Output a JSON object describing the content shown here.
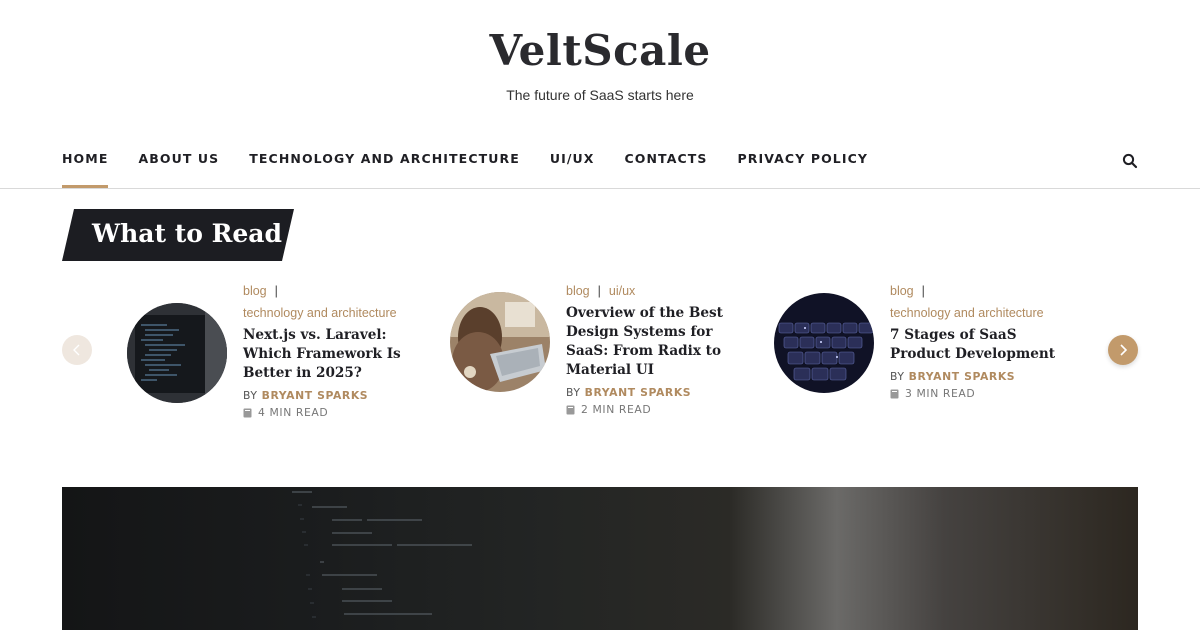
{
  "site": {
    "title": "VeltScale",
    "tagline": "The future of SaaS starts here"
  },
  "nav": {
    "items": [
      {
        "label": "HOME",
        "active": true
      },
      {
        "label": "ABOUT US"
      },
      {
        "label": "TECHNOLOGY AND ARCHITECTURE"
      },
      {
        "label": "UI/UX"
      },
      {
        "label": "CONTACTS"
      },
      {
        "label": "PRIVACY POLICY"
      }
    ],
    "search_icon": "search-icon"
  },
  "section": {
    "title": "What to Read"
  },
  "carousel": {
    "prev_icon": "chevron-left-icon",
    "next_icon": "chevron-right-icon",
    "cards": [
      {
        "categories": [
          "blog",
          "technology and architecture"
        ],
        "title": "Next.js vs. Laravel: Which Framework Is Better in 2025?",
        "by": "BY",
        "author": "BRYANT SPARKS",
        "read_time": "4 MIN READ"
      },
      {
        "categories": [
          "blog",
          "ui/ux"
        ],
        "title": "Overview of the Best Design Systems for SaaS: From Radix to Material UI",
        "by": "BY",
        "author": "BRYANT SPARKS",
        "read_time": "2 MIN READ"
      },
      {
        "categories": [
          "blog",
          "technology and architecture"
        ],
        "title": "7 Stages of SaaS Product Development",
        "by": "BY",
        "author": "BRYANT SPARKS",
        "read_time": "3 MIN READ"
      }
    ]
  },
  "colors": {
    "accent": "#c29a6b",
    "dark": "#1c1d22"
  }
}
